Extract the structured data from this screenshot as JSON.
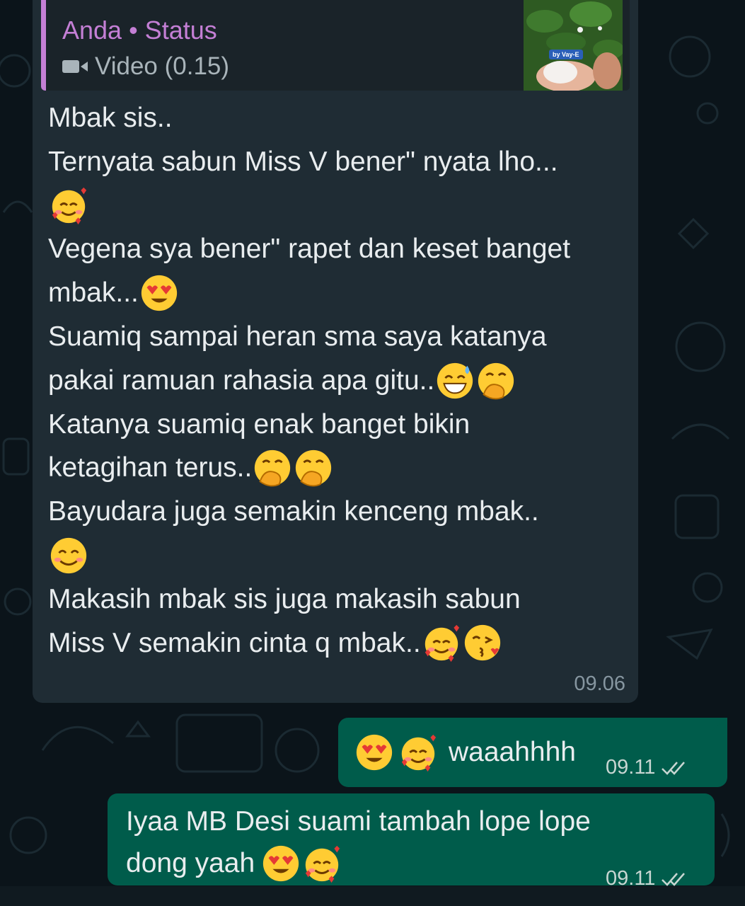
{
  "quoted_status": {
    "title": "Anda • Status",
    "subtitle": "Video (0.15)",
    "thumbnail_badge": "by Vay-E",
    "accent_color": "#c47fd5"
  },
  "incoming": {
    "lines": [
      "Mbak sis..",
      "Ternyata sabun Miss V bener\" nyata lho...",
      "",
      "Vegena sya bener\" rapet dan keset banget",
      "mbak...",
      "Suamiq sampai heran sma saya katanya",
      "pakai ramuan rahasia apa gitu..",
      "Katanya suamiq enak banget bikin",
      "ketagihan terus..",
      "Bayudara juga semakin kenceng mbak..",
      "",
      "Makasih mbak sis juga makasih sabun",
      "Miss V semakin cinta q mbak.."
    ],
    "time": "09.06"
  },
  "outgoing": [
    {
      "text": "waaahhhh",
      "time": "09.11",
      "status": "read"
    },
    {
      "line1": "Iyaa MB Desi suami tambah lope lope",
      "line2": "dong yaah",
      "time": "09.11",
      "status": "read"
    }
  ],
  "colors": {
    "background": "#0b141a",
    "incoming_bubble": "#1f2c34",
    "outgoing_bubble": "#005c4b",
    "timestamp": "#8696a0"
  },
  "icons": [
    "video-icon",
    "smiling-hearts-emoji",
    "heart-eyes-emoji",
    "grinning-sweat-emoji",
    "hand-over-mouth-emoji",
    "smiling-emoji",
    "kiss-heart-emoji",
    "double-check-icon"
  ]
}
